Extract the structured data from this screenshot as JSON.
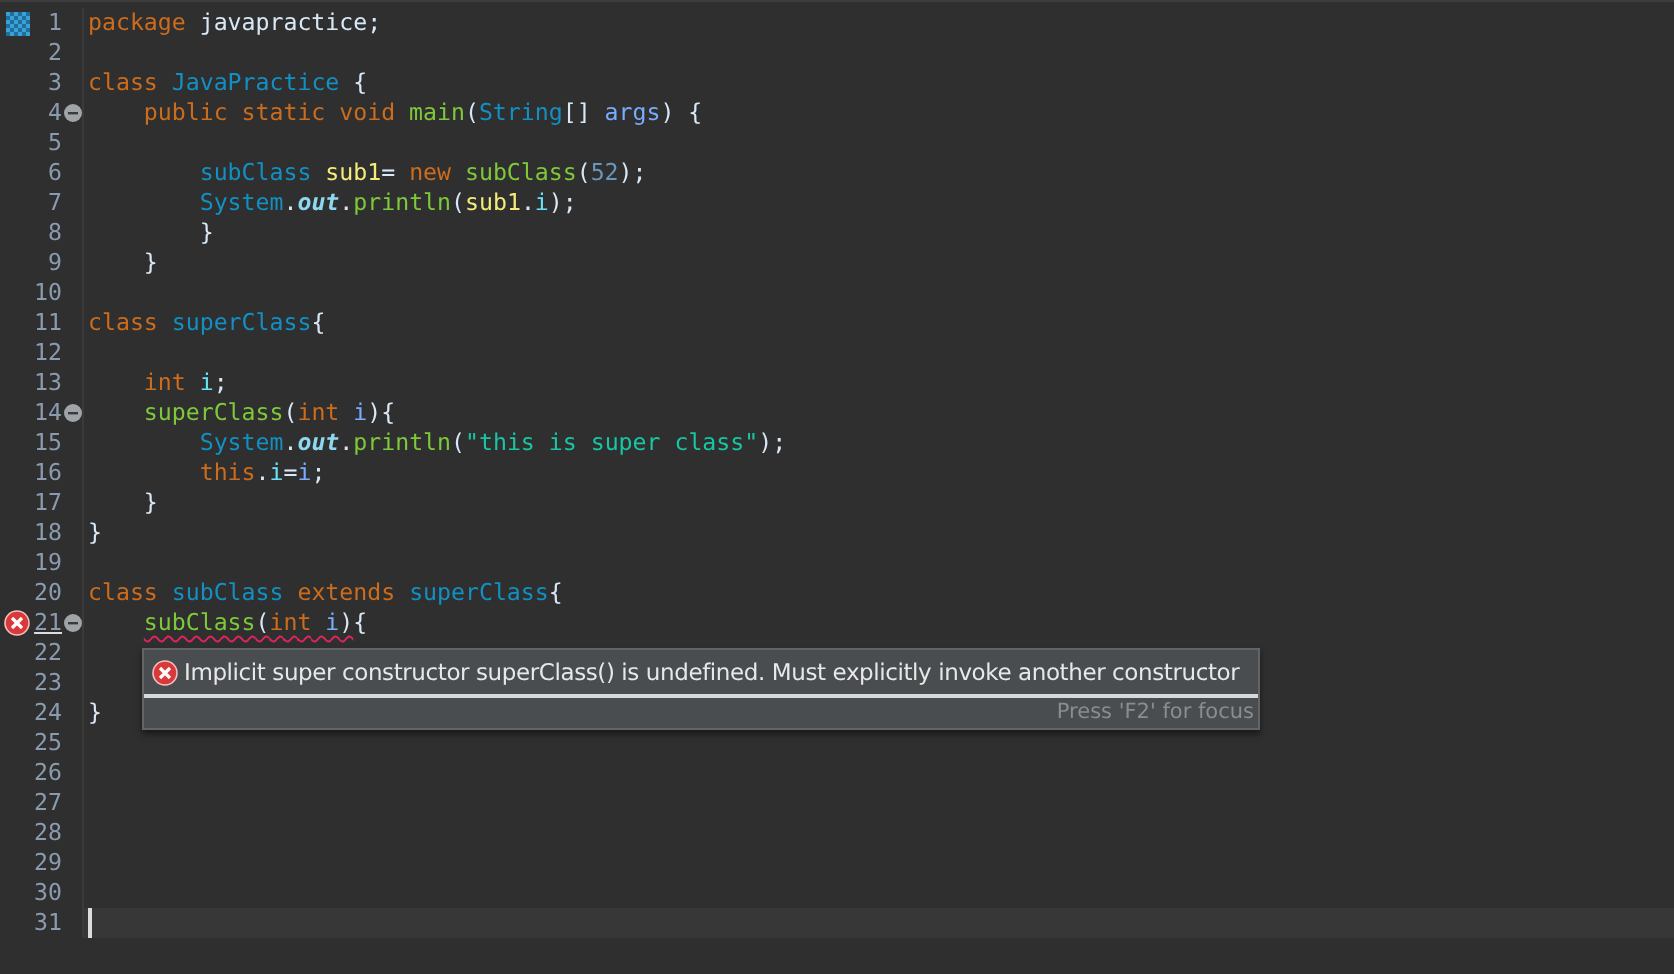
{
  "editor": {
    "lines": [
      {
        "number": "1",
        "bookmark": true,
        "fold": false,
        "error": false,
        "current": false,
        "tokens": [
          {
            "text": "package ",
            "kind": "keyword"
          },
          {
            "text": "javapractice;",
            "kind": "plain"
          }
        ]
      },
      {
        "number": "2",
        "bookmark": false,
        "fold": false,
        "error": false,
        "current": false
      },
      {
        "number": "3",
        "bookmark": false,
        "fold": false,
        "error": false,
        "current": false,
        "tokens": [
          {
            "text": "class ",
            "kind": "keyword"
          },
          {
            "text": "JavaPractice",
            "kind": "type"
          },
          {
            "text": " {",
            "kind": "plain"
          }
        ]
      },
      {
        "number": "4",
        "bookmark": false,
        "fold": true,
        "error": false,
        "current": false,
        "tokens": [
          {
            "text": "    public static void ",
            "kind": "keyword"
          },
          {
            "text": "main",
            "kind": "method"
          },
          {
            "text": "(",
            "kind": "plain"
          },
          {
            "text": "String",
            "kind": "type"
          },
          {
            "text": "[] ",
            "kind": "plain"
          },
          {
            "text": "args",
            "kind": "param"
          },
          {
            "text": ") {",
            "kind": "plain"
          }
        ]
      },
      {
        "number": "5",
        "bookmark": false,
        "fold": false,
        "error": false,
        "current": false
      },
      {
        "number": "6",
        "bookmark": false,
        "fold": false,
        "error": false,
        "current": false,
        "tokens": [
          {
            "text": "        subClass ",
            "kind": "type"
          },
          {
            "text": "sub1",
            "kind": "local"
          },
          {
            "text": "= ",
            "kind": "plain"
          },
          {
            "text": "new ",
            "kind": "keyword"
          },
          {
            "text": "subClass",
            "kind": "method"
          },
          {
            "text": "(",
            "kind": "plain"
          },
          {
            "text": "52",
            "kind": "number"
          },
          {
            "text": ");",
            "kind": "plain"
          }
        ]
      },
      {
        "number": "7",
        "bookmark": false,
        "fold": false,
        "error": false,
        "current": false,
        "tokens": [
          {
            "text": "        System",
            "kind": "type"
          },
          {
            "text": ".",
            "kind": "plain"
          },
          {
            "text": "out",
            "kind": "static"
          },
          {
            "text": ".",
            "kind": "plain"
          },
          {
            "text": "println",
            "kind": "method"
          },
          {
            "text": "(",
            "kind": "plain"
          },
          {
            "text": "sub1",
            "kind": "local"
          },
          {
            "text": ".",
            "kind": "plain"
          },
          {
            "text": "i",
            "kind": "field"
          },
          {
            "text": ");",
            "kind": "plain"
          }
        ]
      },
      {
        "number": "8",
        "bookmark": false,
        "fold": false,
        "error": false,
        "current": false,
        "tokens": [
          {
            "text": "        }",
            "kind": "plain"
          }
        ]
      },
      {
        "number": "9",
        "bookmark": false,
        "fold": false,
        "error": false,
        "current": false,
        "tokens": [
          {
            "text": "    }",
            "kind": "plain"
          }
        ]
      },
      {
        "number": "10",
        "bookmark": false,
        "fold": false,
        "error": false,
        "current": false
      },
      {
        "number": "11",
        "bookmark": false,
        "fold": false,
        "error": false,
        "current": false,
        "tokens": [
          {
            "text": "class ",
            "kind": "keyword"
          },
          {
            "text": "superClass",
            "kind": "type"
          },
          {
            "text": "{",
            "kind": "plain"
          }
        ]
      },
      {
        "number": "12",
        "bookmark": false,
        "fold": false,
        "error": false,
        "current": false
      },
      {
        "number": "13",
        "bookmark": false,
        "fold": false,
        "error": false,
        "current": false,
        "tokens": [
          {
            "text": "    int ",
            "kind": "keyword"
          },
          {
            "text": "i",
            "kind": "field"
          },
          {
            "text": ";",
            "kind": "plain"
          }
        ]
      },
      {
        "number": "14",
        "bookmark": false,
        "fold": true,
        "error": false,
        "current": false,
        "tokens": [
          {
            "text": "    superClass",
            "kind": "method"
          },
          {
            "text": "(",
            "kind": "plain"
          },
          {
            "text": "int ",
            "kind": "keyword"
          },
          {
            "text": "i",
            "kind": "param"
          },
          {
            "text": "){",
            "kind": "plain"
          }
        ]
      },
      {
        "number": "15",
        "bookmark": false,
        "fold": false,
        "error": false,
        "current": false,
        "tokens": [
          {
            "text": "        System",
            "kind": "type"
          },
          {
            "text": ".",
            "kind": "plain"
          },
          {
            "text": "out",
            "kind": "static"
          },
          {
            "text": ".",
            "kind": "plain"
          },
          {
            "text": "println",
            "kind": "method"
          },
          {
            "text": "(",
            "kind": "plain"
          },
          {
            "text": "\"this is super class\"",
            "kind": "string"
          },
          {
            "text": ");",
            "kind": "plain"
          }
        ]
      },
      {
        "number": "16",
        "bookmark": false,
        "fold": false,
        "error": false,
        "current": false,
        "tokens": [
          {
            "text": "        this",
            "kind": "keyword"
          },
          {
            "text": ".",
            "kind": "plain"
          },
          {
            "text": "i",
            "kind": "field"
          },
          {
            "text": "=",
            "kind": "plain"
          },
          {
            "text": "i",
            "kind": "param"
          },
          {
            "text": ";",
            "kind": "plain"
          }
        ]
      },
      {
        "number": "17",
        "bookmark": false,
        "fold": false,
        "error": false,
        "current": false,
        "tokens": [
          {
            "text": "    }",
            "kind": "plain"
          }
        ]
      },
      {
        "number": "18",
        "bookmark": false,
        "fold": false,
        "error": false,
        "current": false,
        "tokens": [
          {
            "text": "}",
            "kind": "plain"
          }
        ]
      },
      {
        "number": "19",
        "bookmark": false,
        "fold": false,
        "error": false,
        "current": false
      },
      {
        "number": "20",
        "bookmark": false,
        "fold": false,
        "error": false,
        "current": false,
        "tokens": [
          {
            "text": "class ",
            "kind": "keyword"
          },
          {
            "text": "subClass ",
            "kind": "type"
          },
          {
            "text": "extends ",
            "kind": "keyword"
          },
          {
            "text": "superClass",
            "kind": "type"
          },
          {
            "text": "{",
            "kind": "plain"
          }
        ]
      },
      {
        "number": "21",
        "bookmark": false,
        "fold": true,
        "error": true,
        "current": false,
        "tokens": [
          {
            "text": "    subClass(int i)",
            "kind": "error-span"
          },
          {
            "text": "{",
            "kind": "plain"
          }
        ]
      },
      {
        "number": "22",
        "bookmark": false,
        "fold": false,
        "error": false,
        "current": false
      },
      {
        "number": "23",
        "bookmark": false,
        "fold": false,
        "error": false,
        "current": false
      },
      {
        "number": "24",
        "bookmark": false,
        "fold": false,
        "error": false,
        "current": false,
        "tokens": [
          {
            "text": "}",
            "kind": "plain"
          }
        ]
      },
      {
        "number": "25",
        "bookmark": false,
        "fold": false,
        "error": false,
        "current": false
      },
      {
        "number": "26",
        "bookmark": false,
        "fold": false,
        "error": false,
        "current": false
      },
      {
        "number": "27",
        "bookmark": false,
        "fold": false,
        "error": false,
        "current": false
      },
      {
        "number": "28",
        "bookmark": false,
        "fold": false,
        "error": false,
        "current": false
      },
      {
        "number": "29",
        "bookmark": false,
        "fold": false,
        "error": false,
        "current": false
      },
      {
        "number": "30",
        "bookmark": false,
        "fold": false,
        "error": false,
        "current": false
      },
      {
        "number": "31",
        "bookmark": false,
        "fold": false,
        "error": false,
        "current": true
      }
    ]
  },
  "tooltip": {
    "message": "Implicit super constructor superClass() is undefined. Must explicitly invoke another constructor",
    "hint": "Press 'F2' for focus"
  }
}
